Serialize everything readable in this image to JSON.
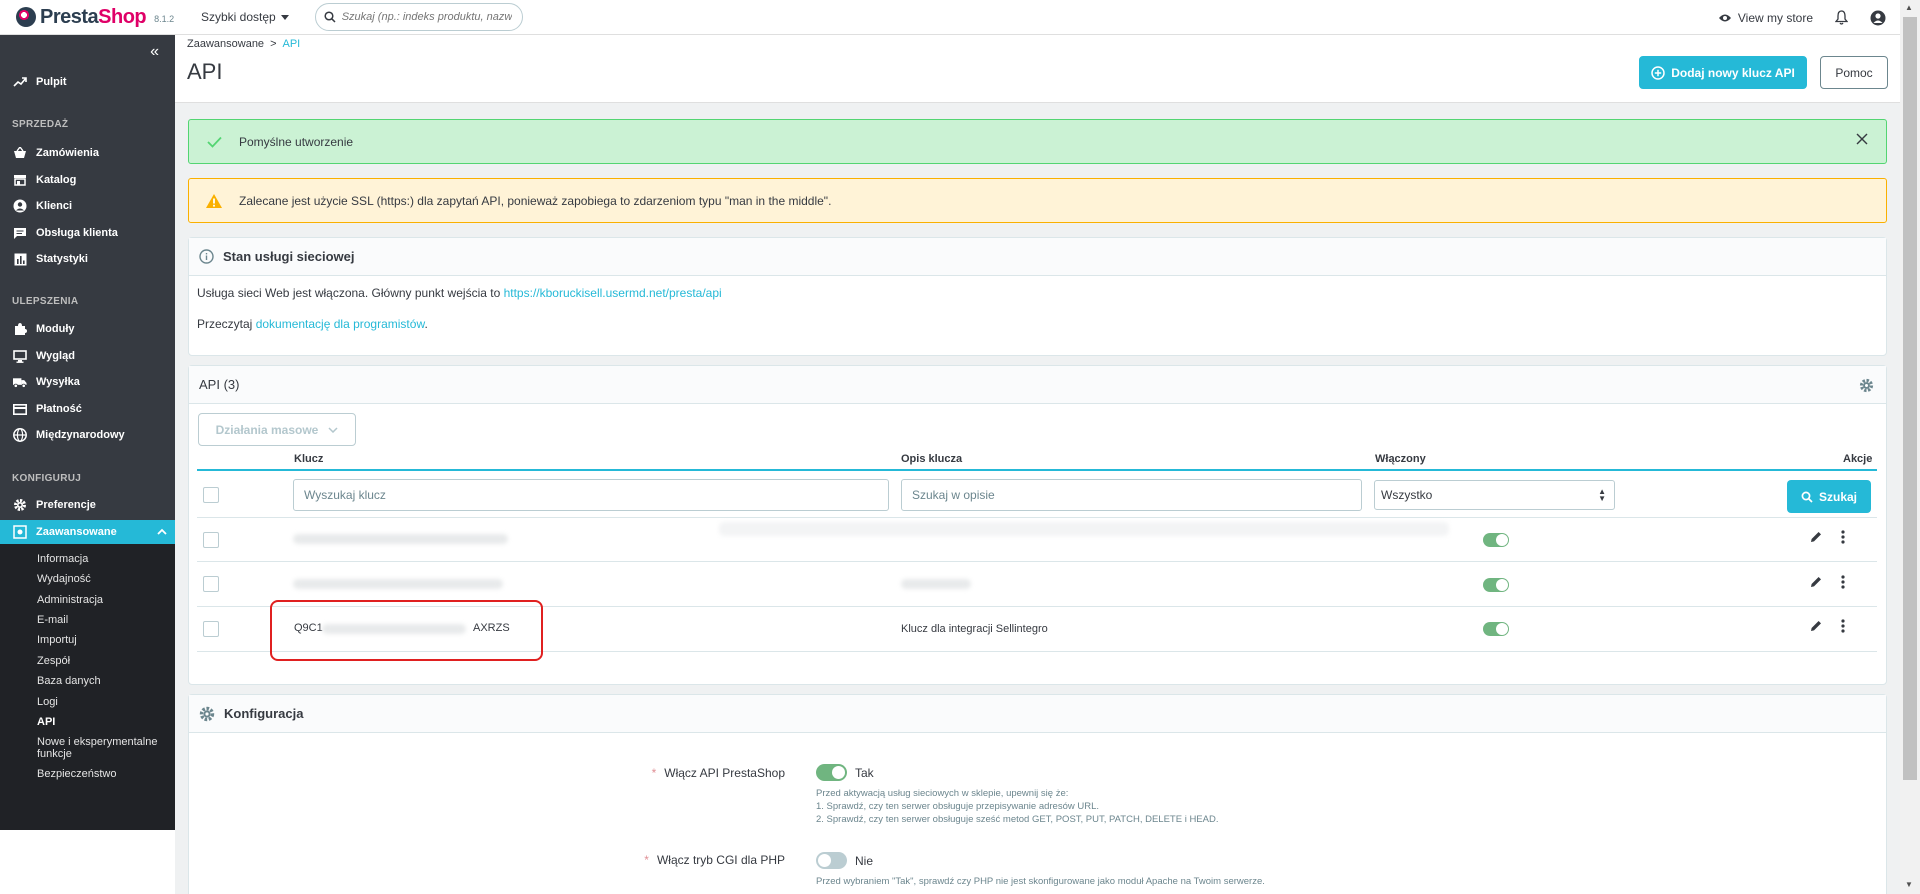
{
  "app": {
    "brand_presta": "Presta",
    "brand_shop": "Shop",
    "version": "8.1.2",
    "quick_access": "Szybki dostęp",
    "search_placeholder": "Szukaj (np.: indeks produktu, nazwa klienta...)",
    "view_store": "View my store"
  },
  "sidebar": {
    "dashboard": "Pulpit",
    "sections": {
      "sell": "SPRZEDAŻ",
      "improve": "ULEPSZENIA",
      "configure": "KONFIGURUJ"
    },
    "items": [
      {
        "label": "Zamówienia",
        "icon": "cart-icon"
      },
      {
        "label": "Katalog",
        "icon": "store-icon"
      },
      {
        "label": "Klienci",
        "icon": "user-icon"
      },
      {
        "label": "Obsługa klienta",
        "icon": "chat-icon"
      },
      {
        "label": "Statystyki",
        "icon": "chart-icon"
      },
      {
        "label": "Moduły",
        "icon": "puzzle-icon"
      },
      {
        "label": "Wygląd",
        "icon": "monitor-icon"
      },
      {
        "label": "Wysyłka",
        "icon": "truck-icon"
      },
      {
        "label": "Płatność",
        "icon": "card-icon"
      },
      {
        "label": "Międzynarodowy",
        "icon": "globe-icon"
      },
      {
        "label": "Preferencje",
        "icon": "gear-icon"
      },
      {
        "label": "Zaawansowane",
        "icon": "settings-icon"
      }
    ],
    "sub_items": [
      "Informacja",
      "Wydajność",
      "Administracja",
      "E-mail",
      "Importuj",
      "Zespół",
      "Baza danych",
      "Logi",
      "API",
      "Nowe i eksperymentalne",
      "funkcje",
      "Bezpieczeństwo"
    ]
  },
  "header": {
    "breadcrumb_parent": "Zaawansowane",
    "breadcrumb_sep": ">",
    "breadcrumb_current": "API",
    "title": "API",
    "add_button": "Dodaj nowy klucz API",
    "help_button": "Pomoc"
  },
  "alerts": {
    "success": "Pomyślne utworzenie",
    "warning": "Zalecane jest użycie SSL (https:) dla zapytań API, ponieważ zapobiega to zdarzeniom typu \"man in the middle\"."
  },
  "service": {
    "title": "Stan usługi sieciowej",
    "status_text": "Usługa sieci Web jest włączona. Główny punkt wejścia to ",
    "status_link": "https://kboruckisell.usermd.net/presta/api",
    "docs_text": "Przeczytaj ",
    "docs_link": "dokumentację dla programistów",
    "docs_end": "."
  },
  "api_table": {
    "title": "API (3)",
    "bulk_actions": "Działania masowe",
    "columns": {
      "key": "Klucz",
      "description": "Opis klucza",
      "enabled": "Włączony",
      "actions": "Akcje"
    },
    "filters": {
      "key_placeholder": "Wyszukaj klucz",
      "desc_placeholder": "Szukaj w opisie",
      "enabled_value": "Wszystko",
      "search_button": "Szukaj"
    },
    "rows": [
      {
        "key_start": "",
        "key_end": "",
        "description": "",
        "enabled": true
      },
      {
        "key_start": "",
        "key_end": "",
        "description": "",
        "enabled": true
      },
      {
        "key_start": "Q9C1",
        "key_end": "AXRZS",
        "description": "Klucz dla integracji Sellintegro",
        "enabled": true
      }
    ]
  },
  "config": {
    "title": "Konfiguracja",
    "enable_api_label": "Włącz API PrestaShop",
    "enable_api_value": "Tak",
    "enable_api_help": [
      "Przed aktywacją usług sieciowych w sklepie, upewnij się że:",
      "1. Sprawdź, czy ten serwer obsługuje przepisywanie adresów URL.",
      "2. Sprawdź, czy ten serwer obsługuje sześć metod GET, POST, PUT, PATCH, DELETE i HEAD."
    ],
    "cgi_label": "Włącz tryb CGI dla PHP",
    "cgi_value": "Nie",
    "cgi_help": "Przed wybraniem \"Tak\", sprawdź czy PHP nie jest skonfigurowane jako moduł Apache na Twoim serwerze.",
    "required_mark": "*"
  }
}
